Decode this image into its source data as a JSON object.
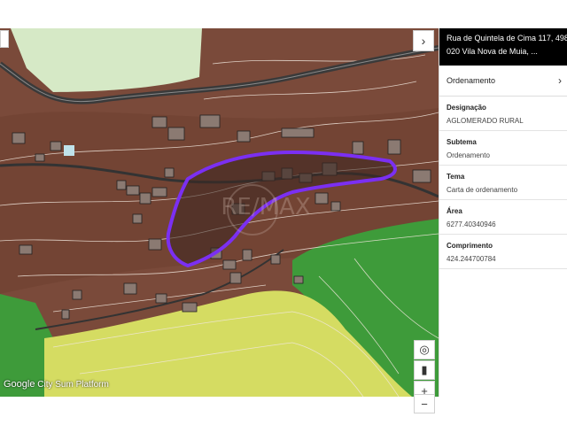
{
  "panel": {
    "address_line1": "Rua de Quintela de Cima 117, 498",
    "address_line2": "020 Vila Nova de Muia, ...",
    "tab_label": "Ordenamento",
    "fields": [
      {
        "label": "Designação",
        "value": "AGLOMERADO RURAL"
      },
      {
        "label": "Subtema",
        "value": "Ordenamento"
      },
      {
        "label": "Tema",
        "value": "Carta de ordenamento"
      },
      {
        "label": "Área",
        "value": "6277.40340946"
      },
      {
        "label": "Comprimento",
        "value": "424.244700784"
      }
    ]
  },
  "map": {
    "attribution": "Google",
    "attribution_extra": "City Sum Platform",
    "controls": {
      "locate": "◎",
      "layers": "▮",
      "zoom_in": "+",
      "zoom_out": "−",
      "collapse": "›"
    },
    "colors": {
      "land_brown": "#7a4a3a",
      "urban_green": "#d6e9c6",
      "agri_green": "#3e9b3a",
      "yellow_green": "#d5dc62",
      "road": "#3a3a3a",
      "parcel_outline": "#7b2ff2"
    },
    "icons": {
      "collapse": "chevron-right-icon",
      "locate": "locate-icon",
      "layers": "layers-icon",
      "zoom_in": "plus-icon",
      "zoom_out": "minus-icon",
      "pegman": "pegman-icon"
    }
  }
}
